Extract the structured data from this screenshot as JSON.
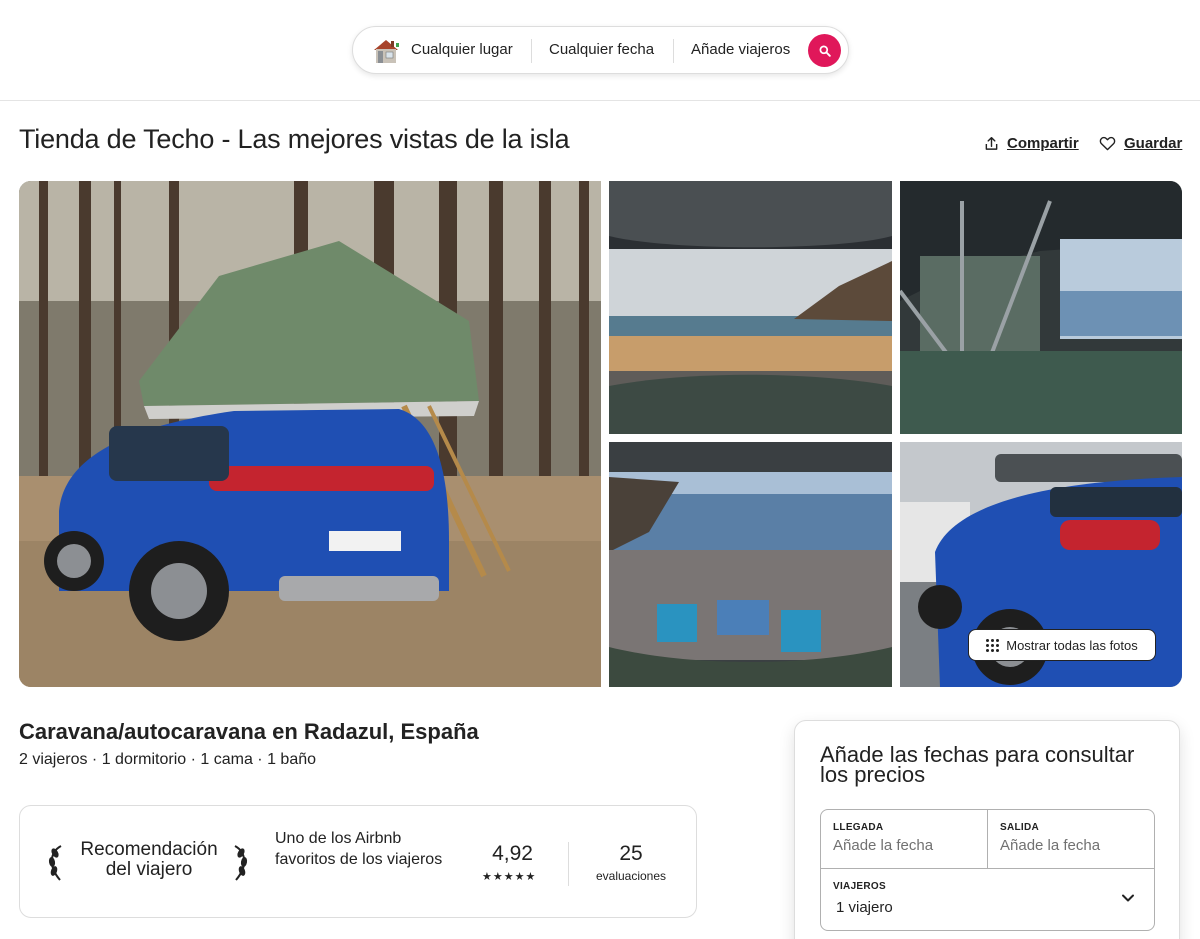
{
  "search": {
    "place": "Cualquier lugar",
    "date": "Cualquier fecha",
    "guests": "Añade viajeros",
    "accent": "#e0175a"
  },
  "listing": {
    "title": "Tienda de Techo - Las mejores vistas de la isla",
    "share_label": "Compartir",
    "save_label": "Guardar",
    "show_all_photos": "Mostrar todas las fotos",
    "subtitle": "Caravana/autocaravana en Radazul, España",
    "details": "2 viajeros · 1 dormitorio · 1 cama · 1 baño"
  },
  "guest_favorite": {
    "badge_line1": "Recomendación",
    "badge_line2": "del viajero",
    "description": "Uno de los Airbnb favoritos de los viajeros",
    "rating": "4,92",
    "stars": "★★★★★",
    "review_count": "25",
    "review_label": "evaluaciones"
  },
  "booking": {
    "title": "Añade las fechas para consultar los precios",
    "checkin_label": "LLEGADA",
    "checkin_value": "Añade la fecha",
    "checkout_label": "SALIDA",
    "checkout_value": "Añade la fecha",
    "guests_label": "VIAJEROS",
    "guests_value": "1 viajero"
  },
  "icons": [
    "house-logo-icon",
    "search-icon",
    "share-icon",
    "heart-icon",
    "grid-dots-icon",
    "laurel-left-icon",
    "laurel-right-icon",
    "chevron-down-icon"
  ]
}
